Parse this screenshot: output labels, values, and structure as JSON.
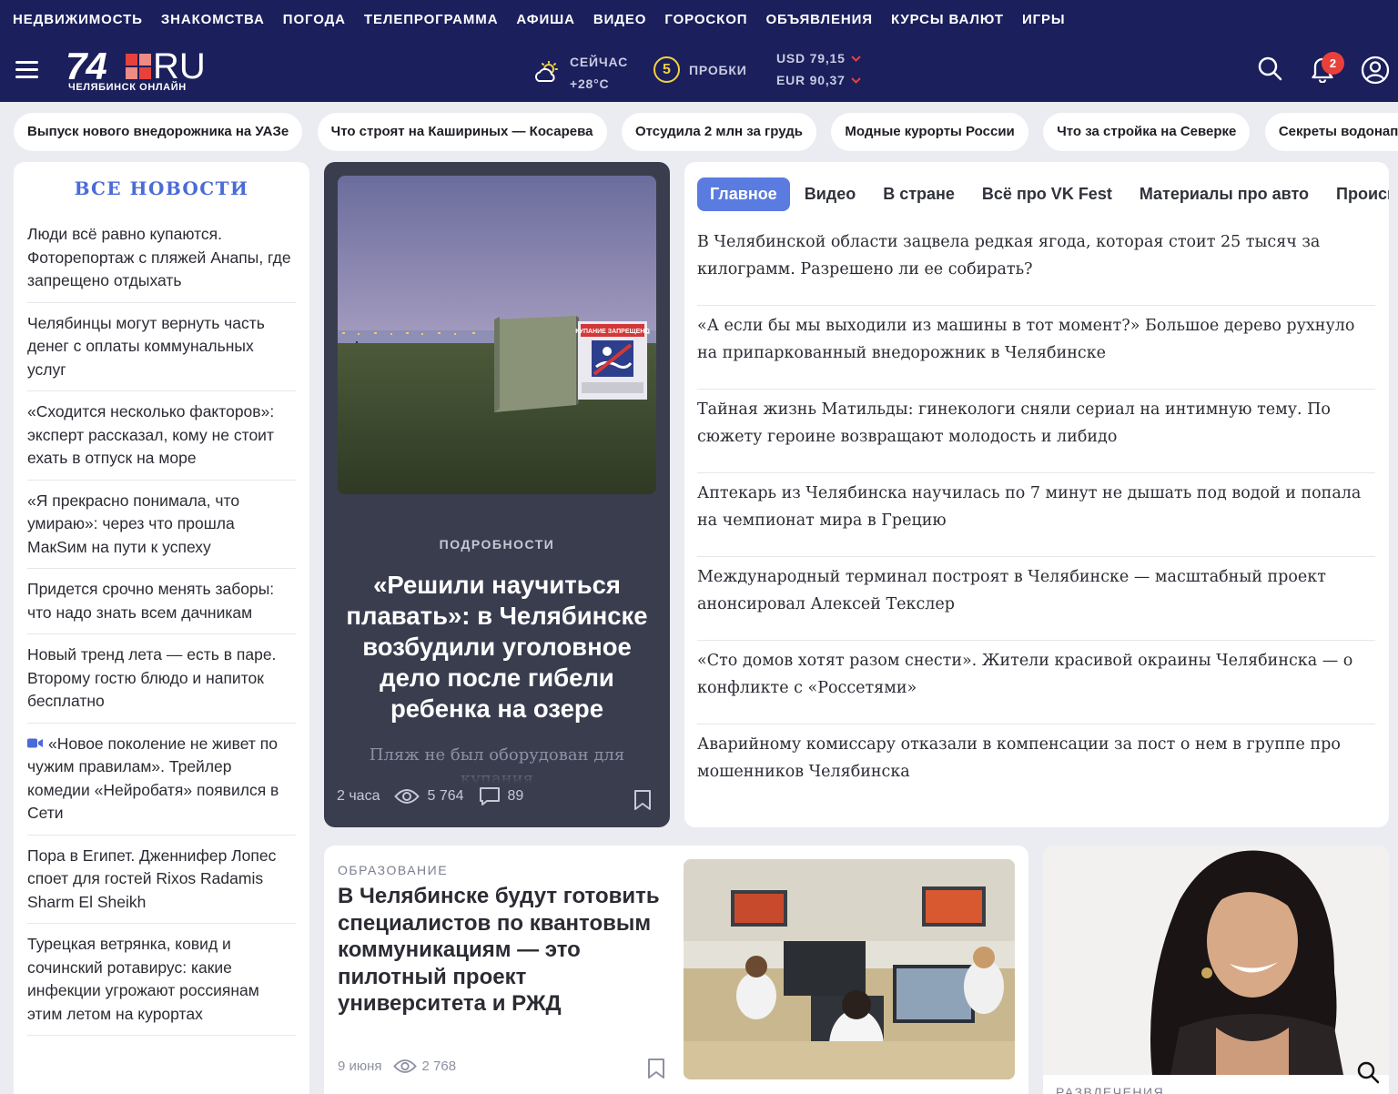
{
  "topnav": [
    "НЕДВИЖИМОСТЬ",
    "ЗНАКОМСТВА",
    "ПОГОДА",
    "ТЕЛЕПРОГРАММА",
    "АФИША",
    "ВИДЕО",
    "ГОРОСКОП",
    "ОБЪЯВЛЕНИЯ",
    "КУРСЫ ВАЛЮТ",
    "ИГРЫ"
  ],
  "header": {
    "logo_main": "74",
    "logo_ru": "RU",
    "logo_sub": "ЧЕЛЯБИНСК ОНЛАЙН",
    "weather_label": "СЕЙЧАС",
    "weather_temp": "+28°C",
    "weather_icon": "sun-cloud-icon",
    "traffic_score": "5",
    "traffic_label": "ПРОБКИ",
    "usd": "USD 79,15",
    "eur": "EUR 90,37",
    "notifications_count": "2"
  },
  "chips": [
    "Выпуск нового внедорожника на УАЗе",
    "Что строят на Кашириных — Косарева",
    "Отсудила 2 млн за грудь",
    "Модные курорты России",
    "Что за стройка на Северке",
    "Секреты водонапо"
  ],
  "all_news": {
    "title": "ВСЕ НОВОСТИ",
    "items": [
      "Люди всё равно купаются. Фоторепортаж с пляжей Анапы, где запрещено отдыхать",
      "Челябинцы могут вернуть часть денег с оплаты коммунальных услуг",
      "«Сходится несколько факторов»: эксперт рассказал, кому не стоит ехать в отпуск на море",
      "«Я прекрасно понимала, что умираю»: через что прошла МакSим на пути к успеху",
      "Придется срочно менять заборы: что надо знать всем дачникам",
      "Новый тренд лета — есть в паре. Второму гостю блюдо и напиток бесплатно",
      "«Новое поколение не живет по чужим правилам». Трейлер комедии «Нейробатя» появился в Сети",
      "Пора в Египет. Дженнифер Лопес споет для гостей Rixos Radamis Sharm El Sheikh",
      "Турецкая ветрянка, ковид и сочинский ротавирус: какие инфекции угрожают россиянам этим летом на курортах"
    ]
  },
  "featured": {
    "rubric": "ПОДРОБНОСТИ",
    "sign_text": "КУПАНИЕ ЗАПРЕЩЕНО",
    "title": "«Решили научиться плавать»: в Челябинске возбудили уголовное дело после гибели ребенка на озере",
    "lead": "Пляж не был оборудован для купания",
    "time": "2 часа",
    "views": "5 764",
    "comments": "89"
  },
  "tabs": [
    "Главное",
    "Видео",
    "В стране",
    "Всё про VK Fest",
    "Материалы про авто",
    "Происшествия"
  ],
  "headlines": [
    "В Челябинской области зацвела редкая ягода, которая стоит 25 тысяч за килограмм. Разрешено ли ее собирать?",
    "«А если бы мы выходили из машины в тот момент?» Большое дерево рухнуло на припаркованный внедорожник в Челябинске",
    "Тайная жизнь Матильды: гинекологи сняли сериал на интимную тему. По сюжету героине возвращают молодость и либидо",
    "Аптекарь из Челябинска научилась по 7 минут не дышать под водой и попала на чемпионат мира в Грецию",
    "Международный терминал построят в Челябинске — масштабный проект анонсировал Алексей Текслер",
    "«Сто домов хотят разом снести». Жители красивой окраины Челябинска — о конфликте с «Россетями»",
    "Аварийному комиссару отказали в компенсации за пост о нем в группе про мошенников Челябинска"
  ],
  "bottom_card": {
    "rubric": "ОБРАЗОВАНИЕ",
    "title": "В Челябинске будут готовить специалистов по квантовым коммуникациям — это пилотный проект университета и РЖД",
    "date": "9 июня",
    "views": "2 768"
  },
  "right_card": {
    "rubric": "РАЗВЛЕЧЕНИЯ"
  }
}
